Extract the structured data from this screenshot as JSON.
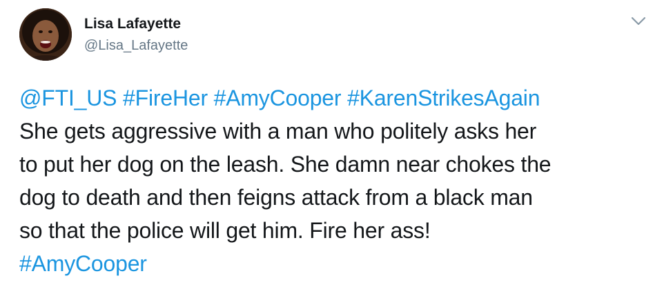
{
  "author": {
    "name": "Lisa Lafayette",
    "handle": "@Lisa_Lafayette"
  },
  "menu": {
    "icon": "chevron-down-icon"
  },
  "tweet": {
    "tags_line": [
      "@FTI_US",
      "#FireHer",
      "#AmyCooper",
      "#KarenStrikesAgain"
    ],
    "lines": [
      "She gets aggressive with a man who politely asks her",
      "to put her dog on the leash. She damn near chokes the",
      "dog to death and then feigns attack from a black man",
      "so that the police will get him. Fire her ass!"
    ],
    "closing_tag": "#AmyCooper"
  },
  "colors": {
    "link": "#1b95e0",
    "text": "#14171a",
    "muted": "#657786"
  }
}
